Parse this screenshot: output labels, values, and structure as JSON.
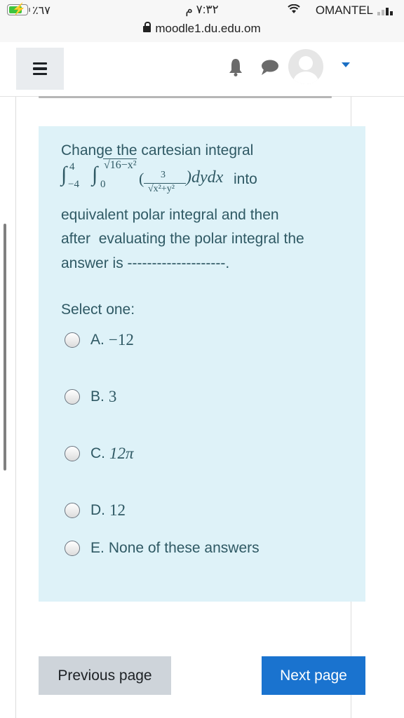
{
  "status_bar": {
    "battery_percent": "٪٦٧",
    "time": "٧:٣٢ م",
    "carrier": "OMANTEL",
    "url": "moodle1.du.edu.om"
  },
  "navbar": {
    "menu_icon": "hamburger-icon",
    "notifications_icon": "bell-icon",
    "messages_icon": "chat-bubble-icon",
    "avatar_icon": "user-avatar-icon",
    "dropdown_icon": "caret-down-icon",
    "accent_color": "#1a6fc4"
  },
  "question": {
    "line1": "Change the cartesian integral",
    "integral": {
      "outer_upper": "4",
      "outer_lower": "−4",
      "inner_upper": "√16−x²",
      "inner_lower": "0",
      "numerator": "3",
      "denominator": "√x²+y²",
      "differentials": ")dydx",
      "open_paren": "(",
      "trailing_text": "into"
    },
    "line3": "equivalent polar integral and then",
    "line4": "after  evaluating the polar integral the",
    "line5": "answer is --------------------.",
    "select_label": "Select one:",
    "options": [
      {
        "letter": "A.",
        "value": "−12"
      },
      {
        "letter": "B.",
        "value": "3"
      },
      {
        "letter": "C.",
        "value": "12π"
      },
      {
        "letter": "D.",
        "value": "12"
      },
      {
        "letter": "E.",
        "value": "None of these answers"
      }
    ],
    "background_color": "#def2f8"
  },
  "navigation": {
    "previous_label": "Previous page",
    "next_label": "Next page",
    "next_color": "#1a73cf"
  }
}
